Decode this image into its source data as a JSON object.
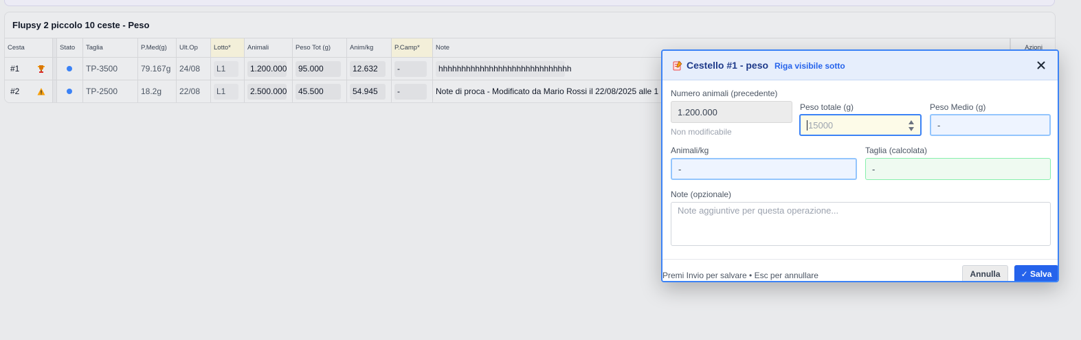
{
  "card": {
    "title": "Flupsy 2 piccolo 10 ceste - Peso"
  },
  "table": {
    "headers": {
      "cesta": "Cesta",
      "stato": "Stato",
      "taglia": "Taglia",
      "pmed": "P.Med(g)",
      "ultop": "Ult.Op",
      "lotto": "Lotto*",
      "animali": "Animali",
      "peso": "Peso Tot (g)",
      "animkg": "Anim/kg",
      "pcamp": "P.Camp*",
      "note": "Note",
      "azioni": "Azioni"
    },
    "rows": [
      {
        "cesta": "#1",
        "icon": "trophy-icon",
        "taglia": "TP-3500",
        "pmed": "79.167g",
        "ultop": "24/08",
        "lotto": "L1",
        "animali": "1.200.000",
        "peso": "95.000",
        "animkg": "12.632",
        "pcamp": "-",
        "note": "hhhhhhhhhhhhhhhhhhhhhhhhhhhhh"
      },
      {
        "cesta": "#2",
        "icon": "warning-icon",
        "taglia": "TP-2500",
        "pmed": "18.2g",
        "ultop": "22/08",
        "lotto": "L1",
        "animali": "2.500.000",
        "peso": "45.500",
        "animkg": "54.945",
        "pcamp": "-",
        "note": "Note di proca - Modificato da Mario Rossi il 22/08/2025 alle 1"
      }
    ]
  },
  "dialog": {
    "title": "Cestello #1 - peso",
    "subtitle": "Riga visibile sotto",
    "close_icon": "close-icon",
    "fields": {
      "prev_label": "Numero animali (precedente)",
      "prev_value": "1.200.000",
      "prev_hint": "Non modificabile",
      "peso_label": "Peso totale (g)",
      "peso_placeholder": "15000",
      "medio_label": "Peso Medio (g)",
      "medio_value": "-",
      "animkg_label": "Animali/kg",
      "animkg_value": "-",
      "taglia_label": "Taglia (calcolata)",
      "taglia_value": "-",
      "note_label": "Note (opzionale)",
      "note_placeholder": "Note aggiuntive per questa operazione..."
    },
    "footer": {
      "hint": "Premi Invio per salvare • Esc per annullare",
      "cancel_label": "Annulla",
      "save_label": "✓ Salva"
    }
  },
  "colors": {
    "accent": "#2563eb",
    "status_dot": "#3b82f6",
    "highlight_column": "#f3efd9"
  }
}
